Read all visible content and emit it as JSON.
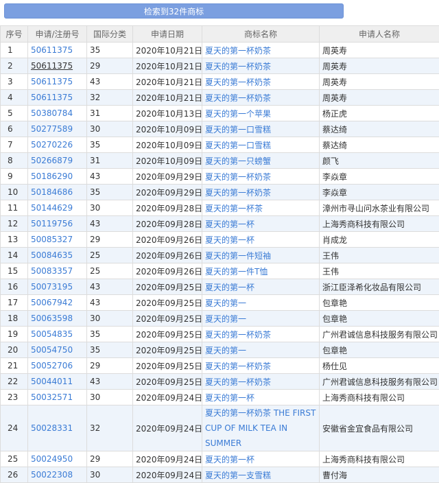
{
  "search_button": "检索到32件商标",
  "headers": {
    "seq": "序号",
    "reg_no": "申请/注册号",
    "class": "国际分类",
    "date": "申请日期",
    "name": "商标名称",
    "applicant": "申请人名称"
  },
  "rows": [
    {
      "seq": "1",
      "reg": "50611375",
      "cls": "35",
      "date": "2020年10月21日",
      "name": "夏天的第一杯奶茶",
      "applicant": "周英寿"
    },
    {
      "seq": "2",
      "reg": "50611375",
      "cls": "29",
      "date": "2020年10月21日",
      "name": "夏天的第一杯奶茶",
      "applicant": "周英寿"
    },
    {
      "seq": "3",
      "reg": "50611375",
      "cls": "43",
      "date": "2020年10月21日",
      "name": "夏天的第一杯奶茶",
      "applicant": "周英寿"
    },
    {
      "seq": "4",
      "reg": "50611375",
      "cls": "32",
      "date": "2020年10月21日",
      "name": "夏天的第一杯奶茶",
      "applicant": "周英寿"
    },
    {
      "seq": "5",
      "reg": "50380784",
      "cls": "31",
      "date": "2020年10月13日",
      "name": "夏天的第一个苹果",
      "applicant": "杨正虎"
    },
    {
      "seq": "6",
      "reg": "50277589",
      "cls": "30",
      "date": "2020年10月09日",
      "name": "夏天的第一口雪糕",
      "applicant": "蔡达绮"
    },
    {
      "seq": "7",
      "reg": "50270226",
      "cls": "35",
      "date": "2020年10月09日",
      "name": "夏天的第一口雪糕",
      "applicant": "蔡达绮"
    },
    {
      "seq": "8",
      "reg": "50266879",
      "cls": "31",
      "date": "2020年10月09日",
      "name": "夏天的第一只螃蟹",
      "applicant": "颜飞"
    },
    {
      "seq": "9",
      "reg": "50186290",
      "cls": "43",
      "date": "2020年09月29日",
      "name": "夏天的第一杯奶茶",
      "applicant": "李焱章"
    },
    {
      "seq": "10",
      "reg": "50184686",
      "cls": "35",
      "date": "2020年09月29日",
      "name": "夏天的第一杯奶茶",
      "applicant": "李焱章"
    },
    {
      "seq": "11",
      "reg": "50144629",
      "cls": "30",
      "date": "2020年09月28日",
      "name": "夏天的第一杯茶",
      "applicant": "漳州市寻山问水茶业有限公司"
    },
    {
      "seq": "12",
      "reg": "50119756",
      "cls": "43",
      "date": "2020年09月28日",
      "name": "夏天的第一杯",
      "applicant": "上海秀商科技有限公司"
    },
    {
      "seq": "13",
      "reg": "50085327",
      "cls": "29",
      "date": "2020年09月26日",
      "name": "夏天的第一杯",
      "applicant": "肖成龙"
    },
    {
      "seq": "14",
      "reg": "50084635",
      "cls": "25",
      "date": "2020年09月26日",
      "name": "夏天的第一件短袖",
      "applicant": "王伟"
    },
    {
      "seq": "15",
      "reg": "50083357",
      "cls": "25",
      "date": "2020年09月26日",
      "name": "夏天的第一件T恤",
      "applicant": "王伟"
    },
    {
      "seq": "16",
      "reg": "50073195",
      "cls": "43",
      "date": "2020年09月25日",
      "name": "夏天的第一杯",
      "applicant": "浙江臣泽希化妆品有限公司"
    },
    {
      "seq": "17",
      "reg": "50067942",
      "cls": "43",
      "date": "2020年09月25日",
      "name": "夏天的第一",
      "applicant": "包章艳"
    },
    {
      "seq": "18",
      "reg": "50063598",
      "cls": "30",
      "date": "2020年09月25日",
      "name": "夏天的第一",
      "applicant": "包章艳"
    },
    {
      "seq": "19",
      "reg": "50054835",
      "cls": "35",
      "date": "2020年09月25日",
      "name": "夏天的第一杯奶茶",
      "applicant": "广州君诚信息科技服务有限公司"
    },
    {
      "seq": "20",
      "reg": "50054750",
      "cls": "35",
      "date": "2020年09月25日",
      "name": "夏天的第一",
      "applicant": "包章艳"
    },
    {
      "seq": "21",
      "reg": "50052706",
      "cls": "29",
      "date": "2020年09月25日",
      "name": "夏天的第一杯奶茶",
      "applicant": "杨仕见"
    },
    {
      "seq": "22",
      "reg": "50044011",
      "cls": "43",
      "date": "2020年09月25日",
      "name": "夏天的第一杯奶茶",
      "applicant": "广州君诚信息科技服务有限公司"
    },
    {
      "seq": "23",
      "reg": "50032571",
      "cls": "30",
      "date": "2020年09月24日",
      "name": "夏天的第一杯",
      "applicant": "上海秀商科技有限公司"
    },
    {
      "seq": "24",
      "reg": "50028331",
      "cls": "32",
      "date": "2020年09月24日",
      "name": "夏天的第一杯奶茶 THE FIRST CUP OF MILK TEA IN SUMMER",
      "applicant": "安徽省金宜食品有限公司"
    },
    {
      "seq": "25",
      "reg": "50024950",
      "cls": "29",
      "date": "2020年09月24日",
      "name": "夏天的第一杯",
      "applicant": "上海秀商科技有限公司"
    },
    {
      "seq": "26",
      "reg": "50022308",
      "cls": "30",
      "date": "2020年09月24日",
      "name": "夏天的第一支雪糕",
      "applicant": "曹付海"
    }
  ]
}
